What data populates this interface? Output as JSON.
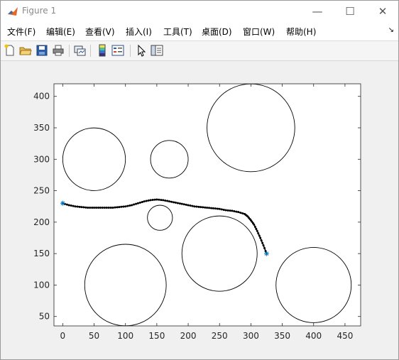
{
  "window": {
    "title": "Figure 1"
  },
  "window_controls": {
    "minimize": "—",
    "maximize": "☐",
    "close": "✕"
  },
  "menu": {
    "items": [
      "文件(F)",
      "编辑(E)",
      "查看(V)",
      "插入(I)",
      "工具(T)",
      "桌面(D)",
      "窗口(W)",
      "帮助(H)"
    ]
  },
  "toolbar": {
    "icons": [
      "new-figure-icon",
      "open-file-icon",
      "save-icon",
      "print-icon",
      "link-plot-icon",
      "colorbar-icon",
      "legend-icon",
      "pointer-icon",
      "property-editor-icon"
    ]
  },
  "chart_data": {
    "type": "scatter",
    "title": "",
    "xlabel": "",
    "ylabel": "",
    "xlim": [
      -14,
      475
    ],
    "ylim": [
      35,
      420
    ],
    "xticks": [
      0,
      50,
      100,
      150,
      200,
      250,
      300,
      350,
      400,
      450
    ],
    "yticks": [
      50,
      100,
      150,
      200,
      250,
      300,
      350,
      400
    ],
    "grid": false,
    "circles": [
      {
        "cx": 50,
        "cy": 300,
        "r": 50
      },
      {
        "cx": 170,
        "cy": 300,
        "r": 30
      },
      {
        "cx": 300,
        "cy": 350,
        "r": 70
      },
      {
        "cx": 155,
        "cy": 207,
        "r": 20
      },
      {
        "cx": 250,
        "cy": 150,
        "r": 60
      },
      {
        "cx": 100,
        "cy": 100,
        "r": 65
      },
      {
        "cx": 400,
        "cy": 100,
        "r": 60
      }
    ],
    "path": {
      "x": [
        0,
        10,
        20,
        30,
        40,
        50,
        60,
        70,
        80,
        90,
        100,
        110,
        120,
        130,
        140,
        150,
        160,
        170,
        180,
        190,
        200,
        210,
        220,
        230,
        240,
        250,
        260,
        270,
        280,
        290,
        295,
        300,
        305,
        310,
        315,
        320,
        325
      ],
      "y": [
        230,
        227,
        225,
        224,
        223,
        223,
        223,
        223,
        223,
        224,
        225,
        227,
        230,
        233,
        235,
        236,
        235,
        233,
        231,
        229,
        227,
        225,
        224,
        223,
        222,
        221,
        219,
        218,
        216,
        213,
        209,
        203,
        196,
        186,
        175,
        163,
        150
      ]
    },
    "start": {
      "x": 0,
      "y": 230
    },
    "end": {
      "x": 325,
      "y": 150
    },
    "colors": {
      "circle": "#000000",
      "path": "#000000",
      "endpoints": "#0072BD"
    }
  }
}
